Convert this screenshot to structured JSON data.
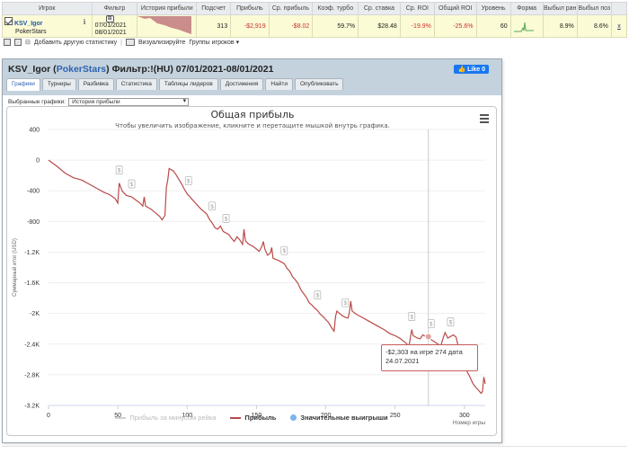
{
  "table": {
    "headers": [
      "Игрок",
      "Фильтр",
      "История прибыли",
      "Подсчет",
      "Прибыль",
      "Ср. прибыль",
      "Коэф. турбо",
      "Ср. ставка",
      "Ср. ROI",
      "Общий ROI",
      "Уровень",
      "Форма",
      "Выбыл ран",
      "Выбыл поз",
      ""
    ],
    "row": {
      "player": "KSV_Igor",
      "site": "PokerStars",
      "date_from": "07/01/2021",
      "date_to": "08/01/2021",
      "count": "313",
      "profit": "-$2,919",
      "avg_profit": "-$8.02",
      "turbo": "59.7%",
      "avg_stake": "$28.48",
      "avg_roi": "-19.9%",
      "total_roi": "-25.6%",
      "level": "60",
      "out_early": "8.9%",
      "out_late": "8.6%",
      "close": "x"
    }
  },
  "toolbar": {
    "add_stat": "Добавить другую статистику",
    "visualize": "Визуализируйте",
    "groups": "Группы игроков"
  },
  "dialog": {
    "player": "KSV_Igor",
    "site": "PokerStars",
    "filter": "Фильтр:!(HU) 07/01/2021-08/01/2021",
    "like": "Like 0",
    "tabs": [
      "Графики",
      "Турниры",
      "Разбивка",
      "Статистика",
      "Таблицы лидеров",
      "Достижения",
      "Найти",
      "Опубликовать"
    ],
    "select_label": "Выбранные графики:",
    "select_value": "История прибыли"
  },
  "chart_data": {
    "type": "line",
    "title": "Общая прибыль",
    "subtitle": "Чтобы увеличить изображение, кликните и перетащите мышкой внутрь графика.",
    "xlabel": "Номер игры",
    "ylabel": "Суммарный итог (USD)",
    "xlim": [
      0,
      315
    ],
    "ylim": [
      -3200,
      400
    ],
    "xticks": [
      0,
      50,
      100,
      150,
      200,
      250,
      300
    ],
    "yticks": [
      400,
      0,
      -400,
      -800,
      -1200,
      -1600,
      -2000,
      -2400,
      -2800,
      -3200
    ],
    "ytick_labels": [
      "400",
      "0",
      "-400",
      "-800",
      "-1.2K",
      "-1.6K",
      "-2K",
      "-2.4K",
      "-2.8K",
      "-3.2K"
    ],
    "series": [
      {
        "name": "Прибыль",
        "color": "#b94a48",
        "points": [
          [
            0,
            0
          ],
          [
            6,
            -80
          ],
          [
            12,
            -170
          ],
          [
            18,
            -230
          ],
          [
            24,
            -260
          ],
          [
            30,
            -320
          ],
          [
            36,
            -380
          ],
          [
            40,
            -420
          ],
          [
            44,
            -450
          ],
          [
            48,
            -500
          ],
          [
            50,
            -560
          ],
          [
            51,
            -300
          ],
          [
            53,
            -400
          ],
          [
            56,
            -460
          ],
          [
            60,
            -480
          ],
          [
            63,
            -520
          ],
          [
            66,
            -560
          ],
          [
            68,
            -600
          ],
          [
            69,
            -480
          ],
          [
            70,
            -600
          ],
          [
            74,
            -640
          ],
          [
            78,
            -700
          ],
          [
            80,
            -730
          ],
          [
            82,
            -780
          ],
          [
            84,
            -720
          ],
          [
            85,
            -360
          ],
          [
            86,
            -260
          ],
          [
            87,
            -110
          ],
          [
            90,
            -140
          ],
          [
            92,
            -190
          ],
          [
            94,
            -250
          ],
          [
            96,
            -310
          ],
          [
            98,
            -380
          ],
          [
            100,
            -440
          ],
          [
            103,
            -500
          ],
          [
            106,
            -560
          ],
          [
            110,
            -640
          ],
          [
            114,
            -700
          ],
          [
            116,
            -770
          ],
          [
            118,
            -820
          ],
          [
            120,
            -880
          ],
          [
            122,
            -900
          ],
          [
            124,
            -860
          ],
          [
            126,
            -930
          ],
          [
            130,
            -970
          ],
          [
            132,
            -1020
          ],
          [
            134,
            -1060
          ],
          [
            136,
            -1000
          ],
          [
            138,
            -1040
          ],
          [
            140,
            -1100
          ],
          [
            141,
            -900
          ],
          [
            142,
            -1050
          ],
          [
            144,
            -1090
          ],
          [
            148,
            -1130
          ],
          [
            152,
            -1190
          ],
          [
            154,
            -1120
          ],
          [
            155,
            -1060
          ],
          [
            156,
            -1160
          ],
          [
            158,
            -1240
          ],
          [
            160,
            -1210
          ],
          [
            161,
            -1140
          ],
          [
            162,
            -1280
          ],
          [
            166,
            -1310
          ],
          [
            170,
            -1350
          ],
          [
            172,
            -1410
          ],
          [
            174,
            -1450
          ],
          [
            176,
            -1520
          ],
          [
            178,
            -1560
          ],
          [
            180,
            -1610
          ],
          [
            182,
            -1690
          ],
          [
            184,
            -1740
          ],
          [
            186,
            -1790
          ],
          [
            188,
            -1860
          ],
          [
            190,
            -1890
          ],
          [
            192,
            -1930
          ],
          [
            194,
            -1960
          ],
          [
            196,
            -2010
          ],
          [
            198,
            -2040
          ],
          [
            200,
            -2080
          ],
          [
            202,
            -2120
          ],
          [
            204,
            -2180
          ],
          [
            206,
            -2230
          ],
          [
            207,
            -2040
          ],
          [
            208,
            -1970
          ],
          [
            210,
            -2000
          ],
          [
            212,
            -2030
          ],
          [
            214,
            -2050
          ],
          [
            216,
            -2060
          ],
          [
            217,
            -1990
          ],
          [
            218,
            -1840
          ],
          [
            219,
            -1970
          ],
          [
            222,
            -2010
          ],
          [
            226,
            -2050
          ],
          [
            230,
            -2090
          ],
          [
            234,
            -2130
          ],
          [
            238,
            -2170
          ],
          [
            242,
            -2210
          ],
          [
            246,
            -2260
          ],
          [
            250,
            -2290
          ],
          [
            254,
            -2330
          ],
          [
            256,
            -2360
          ],
          [
            258,
            -2390
          ],
          [
            260,
            -2430
          ],
          [
            262,
            -2210
          ],
          [
            263,
            -2290
          ],
          [
            266,
            -2320
          ],
          [
            268,
            -2330
          ],
          [
            270,
            -2280
          ],
          [
            272,
            -2300
          ],
          [
            274,
            -2303
          ],
          [
            276,
            -2340
          ],
          [
            280,
            -2390
          ],
          [
            283,
            -2420
          ],
          [
            285,
            -2300
          ],
          [
            286,
            -2250
          ],
          [
            288,
            -2320
          ],
          [
            290,
            -2300
          ],
          [
            292,
            -2280
          ],
          [
            294,
            -2310
          ],
          [
            296,
            -2460
          ],
          [
            298,
            -2600
          ],
          [
            300,
            -2700
          ],
          [
            302,
            -2760
          ],
          [
            304,
            -2830
          ],
          [
            306,
            -2910
          ],
          [
            308,
            -2960
          ],
          [
            310,
            -3000
          ],
          [
            312,
            -3040
          ],
          [
            313,
            -3020
          ],
          [
            314,
            -2830
          ],
          [
            315,
            -2919
          ]
        ]
      },
      {
        "name": "Прибыль за минусом рейка",
        "color": "#dcdcdc"
      }
    ],
    "big_wins_x": [
      51,
      60,
      101,
      118,
      128,
      170,
      194,
      214,
      262,
      276,
      290
    ],
    "legend": [
      "Прибыль за минусом рейка",
      "Прибыль",
      "Значительные выигрыши"
    ],
    "legend_colors": [
      "#d0d0d0",
      "#b94a48",
      "#7cb5ec"
    ],
    "tooltip": {
      "line1": "-$2,303 на игре 274 дата",
      "line2": "24.07.2021",
      "x": 274,
      "y": -2303
    }
  }
}
